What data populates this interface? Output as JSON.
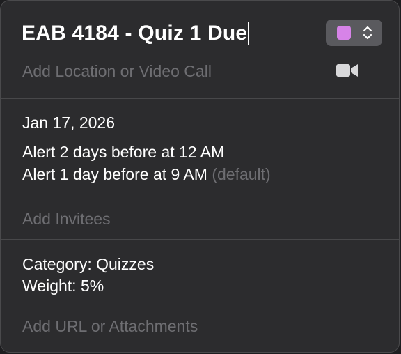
{
  "event": {
    "title": "EAB 4184 - Quiz 1 Due",
    "color": "#d783e8"
  },
  "location": {
    "placeholder": "Add Location or Video Call",
    "video_icon": "video-camera-icon"
  },
  "schedule": {
    "date": "Jan 17, 2026",
    "alerts": [
      {
        "text": "Alert 2 days before at 12 AM",
        "note": ""
      },
      {
        "text": "Alert 1 day before at 9 AM",
        "note": "(default)"
      }
    ]
  },
  "invitees": {
    "placeholder": "Add Invitees"
  },
  "notes": {
    "lines": [
      "Category: Quizzes",
      "Weight: 5%"
    ]
  },
  "attachments": {
    "placeholder": "Add URL or Attachments"
  },
  "icons": {
    "color_picker_arrows": "chevron-up-down-icon"
  },
  "colors": {
    "background": "#2c2c2e",
    "placeholder_text": "#6e6e72",
    "divider": "#48484a",
    "picker_bg": "#5a5a5e"
  }
}
